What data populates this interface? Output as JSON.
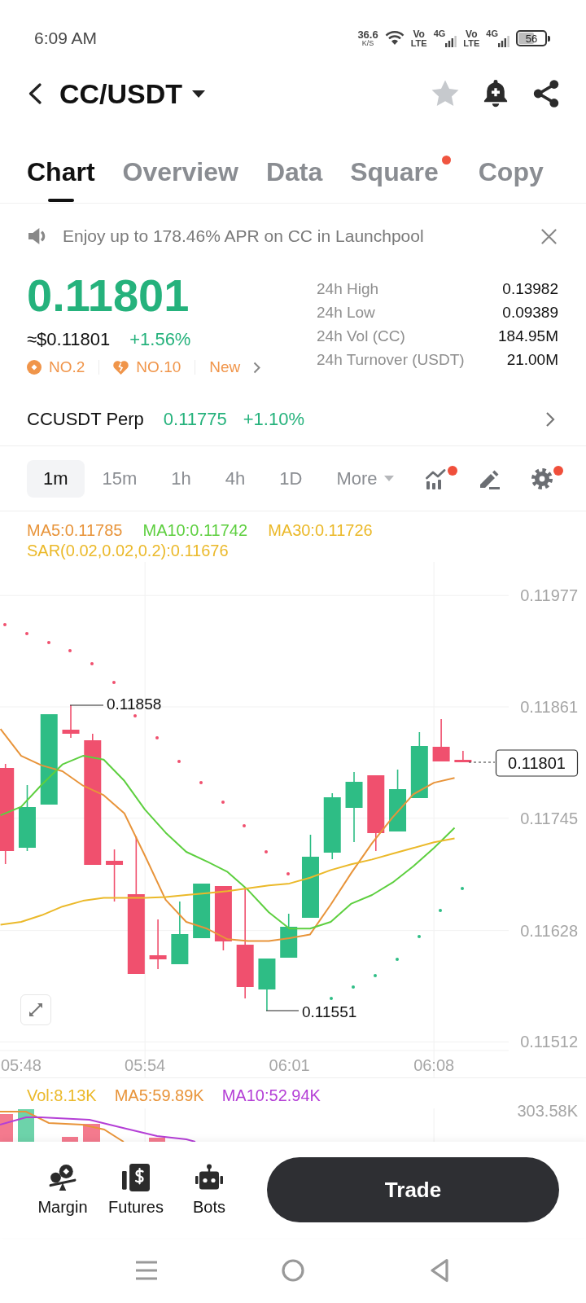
{
  "status_bar": {
    "time": "6:09 AM",
    "speed": "36.6",
    "speed_unit": "K/S",
    "sims": [
      {
        "volte_top": "Vo",
        "volte_bottom": "LTE",
        "network": "4G"
      },
      {
        "volte_top": "Vo",
        "volte_bottom": "LTE",
        "network": "4G"
      }
    ],
    "battery": "56"
  },
  "header": {
    "pair": "CC/USDT"
  },
  "tabs": [
    {
      "label": "Chart",
      "selected": true,
      "dot": false
    },
    {
      "label": "Overview",
      "selected": false,
      "dot": false
    },
    {
      "label": "Data",
      "selected": false,
      "dot": false
    },
    {
      "label": "Square",
      "selected": false,
      "dot": true
    },
    {
      "label": "Copy",
      "selected": false,
      "dot": false
    }
  ],
  "banner": {
    "text": "Enjoy up to 178.46% APR on CC in Launchpool"
  },
  "ticker": {
    "price": "0.11801",
    "usd_price": "≈$0.11801",
    "change": "+1.56%",
    "badges": [
      {
        "kind": "rank",
        "label": "NO.2"
      },
      {
        "kind": "hot",
        "label": "NO.10"
      },
      {
        "kind": "tag",
        "label": "New"
      }
    ],
    "stats": [
      {
        "label": "24h High",
        "value": "0.13982"
      },
      {
        "label": "24h Low",
        "value": "0.09389"
      },
      {
        "label": "24h Vol (CC)",
        "value": "184.95M"
      },
      {
        "label": "24h Turnover (USDT)",
        "value": "21.00M"
      }
    ]
  },
  "perp": {
    "name": "CCUSDT Perp",
    "price": "0.11775",
    "change": "+1.10%"
  },
  "intervals": [
    {
      "label": "1m",
      "selected": true
    },
    {
      "label": "15m",
      "selected": false
    },
    {
      "label": "1h",
      "selected": false
    },
    {
      "label": "4h",
      "selected": false
    },
    {
      "label": "1D",
      "selected": false
    }
  ],
  "more": {
    "label": "More"
  },
  "tools": [
    {
      "kind": "indicators",
      "dot": true
    },
    {
      "kind": "draw",
      "dot": false
    },
    {
      "kind": "settings",
      "dot": true
    }
  ],
  "chart": {
    "sar_legend": {
      "text": "SAR(0.02,0.02,0.2):0.11676",
      "color": "#ebb92a"
    },
    "high_label": "0.11858",
    "low_label": "0.11551",
    "last_price": "0.11801",
    "chart_data": {
      "type": "line",
      "grid": true,
      "categories": [
        null,
        "05:48",
        null,
        null,
        null,
        null,
        null,
        "05:54",
        null,
        null,
        null,
        null,
        null,
        null,
        "06:01",
        null,
        null,
        null,
        null,
        null,
        null,
        "06:08",
        null
      ],
      "ylim": [
        0.11503,
        0.12012
      ],
      "yticks": [
        0.11977,
        0.11861,
        0.11745,
        0.11628,
        0.11512
      ],
      "series": [
        {
          "name": "MA5:0.11785",
          "color": "#e8943a",
          "values": [
            0.11838,
            0.1181,
            0.118,
            0.11794,
            0.11779,
            0.11769,
            0.1175,
            0.11706,
            0.1166,
            0.11637,
            0.1163,
            0.11619,
            0.11617,
            0.11617,
            0.1162,
            0.11624,
            0.11655,
            0.11688,
            0.11719,
            0.11746,
            0.1177,
            0.11782,
            0.11787
          ]
        },
        {
          "name": "MA10:0.11742",
          "color": "#5dcf3f",
          "values": [
            0.11748,
            0.11757,
            0.1178,
            0.11801,
            0.1181,
            0.11806,
            0.11784,
            0.11754,
            0.1173,
            0.1171,
            0.117,
            0.11689,
            0.1167,
            0.11647,
            0.1163,
            0.1163,
            0.11637,
            0.11656,
            0.11665,
            0.11678,
            0.11695,
            0.11714,
            0.11735
          ]
        },
        {
          "name": "MA30:0.11726",
          "color": "#ebb92a",
          "values": [
            0.11634,
            0.11637,
            0.11644,
            0.11653,
            0.11659,
            0.11662,
            0.11662,
            0.11662,
            0.11663,
            0.11665,
            0.11667,
            0.11669,
            0.11672,
            0.11675,
            0.11677,
            0.11683,
            0.11691,
            0.11697,
            0.11702,
            0.11708,
            0.11714,
            0.1172,
            0.11724
          ]
        }
      ]
    }
  },
  "volume": {
    "legend": [
      {
        "text": "Vol:8.13K",
        "color": "#ebb92a"
      },
      {
        "text": "MA5:59.89K",
        "color": "#e8943a"
      },
      {
        "text": "MA10:52.94K",
        "color": "#b43fd6"
      }
    ],
    "y_label": "303.58K"
  },
  "bottom_bar": {
    "shortcuts": [
      {
        "kind": "margin",
        "label": "Margin"
      },
      {
        "kind": "futures",
        "label": "Futures"
      },
      {
        "kind": "bots",
        "label": "Bots"
      }
    ],
    "trade": "Trade"
  }
}
